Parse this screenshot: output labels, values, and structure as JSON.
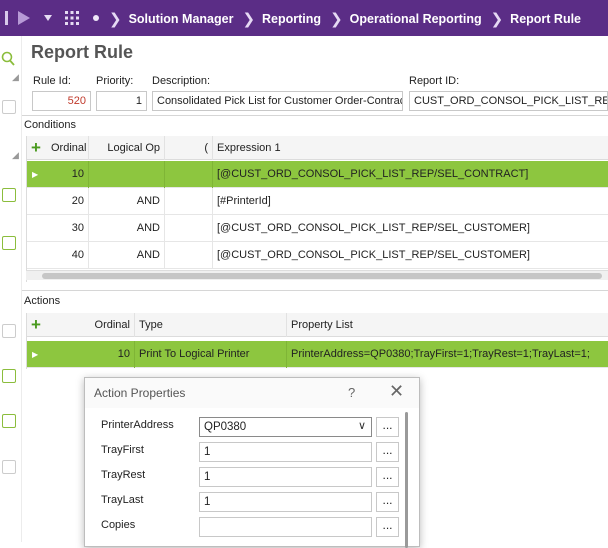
{
  "breadcrumb": [
    "Solution Manager",
    "Reporting",
    "Operational Reporting",
    "Report Rule"
  ],
  "page_title": "Report Rule",
  "fields": {
    "rule_id": {
      "label": "Rule Id:",
      "value": "520"
    },
    "priority": {
      "label": "Priority:",
      "value": "1"
    },
    "description": {
      "label": "Description:",
      "value": "Consolidated Pick List for Customer Order-Contract"
    },
    "report_id": {
      "label": "Report ID:",
      "value": "CUST_ORD_CONSOL_PICK_LIST_REP"
    }
  },
  "conditions": {
    "label": "Conditions",
    "columns": [
      "Ordinal",
      "Logical Op",
      "(",
      "Expression 1"
    ],
    "rows": [
      {
        "ordinal": "10",
        "logical_op": "",
        "paren": "",
        "expression": "[@CUST_ORD_CONSOL_PICK_LIST_REP/SEL_CONTRACT]"
      },
      {
        "ordinal": "20",
        "logical_op": "AND",
        "paren": "",
        "expression": "[#PrinterId]"
      },
      {
        "ordinal": "30",
        "logical_op": "AND",
        "paren": "",
        "expression": "[@CUST_ORD_CONSOL_PICK_LIST_REP/SEL_CUSTOMER]"
      },
      {
        "ordinal": "40",
        "logical_op": "AND",
        "paren": "",
        "expression": "[@CUST_ORD_CONSOL_PICK_LIST_REP/SEL_CUSTOMER]"
      }
    ]
  },
  "actions": {
    "label": "Actions",
    "columns": [
      "Ordinal",
      "Type",
      "Property List"
    ],
    "rows": [
      {
        "ordinal": "10",
        "type": "Print To Logical Printer",
        "property_list": "PrinterAddress=QP0380;TrayFirst=1;TrayRest=1;TrayLast=1;"
      }
    ]
  },
  "dialog": {
    "title": "Action Properties",
    "help": "?",
    "properties": [
      {
        "label": "PrinterAddress",
        "value": "QP0380"
      },
      {
        "label": "TrayFirst",
        "value": "1"
      },
      {
        "label": "TrayRest",
        "value": "1"
      },
      {
        "label": "TrayLast",
        "value": "1"
      },
      {
        "label": "Copies",
        "value": ""
      }
    ],
    "browse_label": "..."
  },
  "colors": {
    "header": "#5b2d86",
    "selected_row": "#8dc63f",
    "accent": "#4a9a1f"
  }
}
